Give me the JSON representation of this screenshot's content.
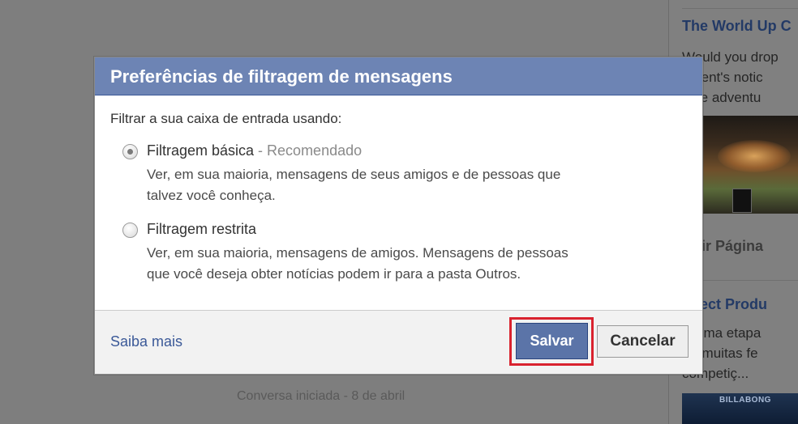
{
  "dialog": {
    "title": "Preferências de filtragem de mensagens",
    "intro": "Filtrar a sua caixa de entrada usando:",
    "options": [
      {
        "label": "Filtragem básica",
        "tag": " - Recomendado",
        "description_lines": [
          "Ver, em sua maioria, mensagens de seus amigos e de pessoas que",
          "talvez você conheça."
        ],
        "selected": true
      },
      {
        "label": "Filtragem restrita",
        "tag": "",
        "description_lines": [
          "Ver, em sua maioria, mensagens de amigos. Mensagens de pessoas",
          "que você deseja obter notícias podem ir para a pasta Outros."
        ],
        "selected": false
      }
    ],
    "learn_more": "Saiba mais",
    "save_label": "Salvar",
    "cancel_label": "Cancelar"
  },
  "background": {
    "conversation_note": "Conversa iniciada - 8 de abril",
    "right_rail": {
      "title_1": "The World Up C",
      "text_1": [
        "Would you drop",
        "oment's notic",
        "time adventu"
      ],
      "like_page": "urtir Página",
      "title_2": "nnect Produ",
      "text_2": [
        "is uma etapa",
        "ro, muitas fe",
        "competiç..."
      ],
      "banner_text": "BILLABONG"
    }
  },
  "colors": {
    "header_blue": "#6d84b4",
    "save_button": "#5b74a8",
    "link": "#3b5998",
    "highlight_red": "#d9222e"
  }
}
